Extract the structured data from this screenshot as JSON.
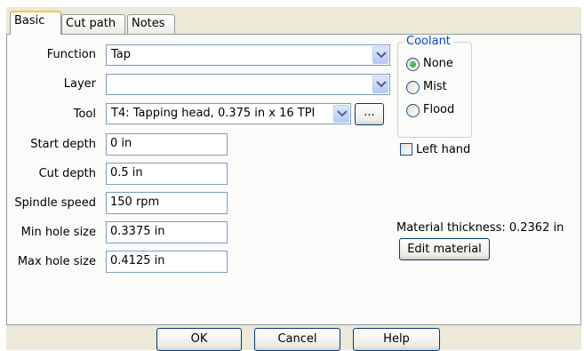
{
  "tabs": [
    {
      "label": "Basic",
      "active": true
    },
    {
      "label": "Cut path",
      "active": false
    },
    {
      "label": "Notes",
      "active": false
    }
  ],
  "fields": {
    "function": {
      "label": "Function",
      "value": "Tap"
    },
    "layer": {
      "label": "Layer",
      "value": ""
    },
    "tool": {
      "label": "Tool",
      "value": "T4: Tapping head, 0.375 in x 16 TPI",
      "browse_label": "..."
    },
    "start_depth": {
      "label": "Start depth",
      "value": "0 in"
    },
    "cut_depth": {
      "label": "Cut depth",
      "value": "0.5 in"
    },
    "spindle_speed": {
      "label": "Spindle speed",
      "value": "150 rpm"
    },
    "min_hole_size": {
      "label": "Min hole size",
      "value": "0.3375 in"
    },
    "max_hole_size": {
      "label": "Max hole size",
      "value": "0.4125 in"
    }
  },
  "coolant": {
    "title": "Coolant",
    "options": [
      {
        "label": "None",
        "selected": true
      },
      {
        "label": "Mist",
        "selected": false
      },
      {
        "label": "Flood",
        "selected": false
      }
    ]
  },
  "left_hand": {
    "label": "Left hand",
    "checked": false
  },
  "material": {
    "thickness_text": "Material thickness: 0.2362 in",
    "edit_label": "Edit material"
  },
  "buttons": {
    "ok": "OK",
    "cancel": "Cancel",
    "help": "Help"
  },
  "colors": {
    "accent": "#0046d5",
    "tab_highlight": "#ffc83c",
    "panel": "#fbfbf9",
    "dialog": "#ece9d8"
  }
}
